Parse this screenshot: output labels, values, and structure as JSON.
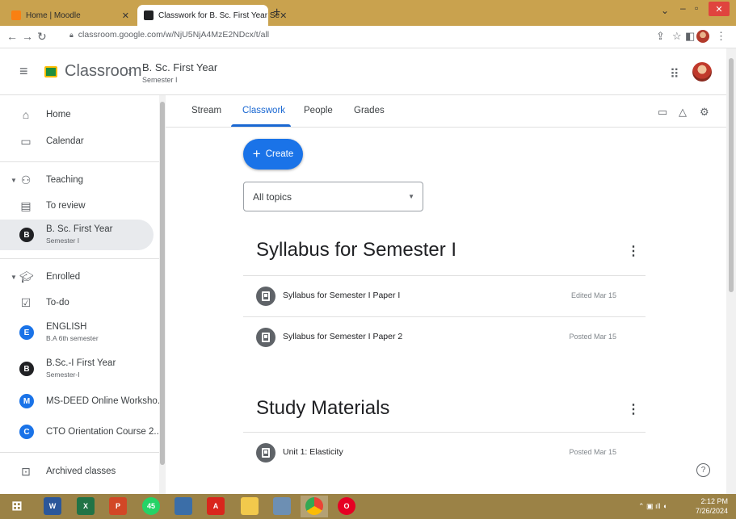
{
  "browser": {
    "tabs": [
      {
        "title": "Home | Moodle",
        "active": false
      },
      {
        "title": "Classwork for B. Sc. First Year Se",
        "active": true
      }
    ],
    "url": "classroom.google.com/w/NjU5NjA4MzE2NDcx/t/all"
  },
  "app": {
    "name": "Classroom",
    "class_title": "B. Sc. First Year",
    "class_subtitle": "Semester I"
  },
  "sidebar": {
    "home": "Home",
    "calendar": "Calendar",
    "teaching": "Teaching",
    "to_review": "To review",
    "teaching_classes": [
      {
        "initial": "B",
        "name": "B. Sc. First Year",
        "sub": "Semester I",
        "color": "#202124",
        "selected": true
      }
    ],
    "enrolled": "Enrolled",
    "todo": "To-do",
    "enrolled_classes": [
      {
        "initial": "E",
        "name": "ENGLISH",
        "sub": "B.A 6th semester",
        "color": "#1a73e8"
      },
      {
        "initial": "B",
        "name": "B.Sc.-I First Year",
        "sub": "Semester-I",
        "color": "#202124"
      },
      {
        "initial": "M",
        "name": "MS-DEED Online Worksho...",
        "sub": "",
        "color": "#1a73e8"
      },
      {
        "initial": "C",
        "name": "CTO Orientation Course 2...",
        "sub": "",
        "color": "#1a73e8"
      }
    ],
    "archived": "Archived classes"
  },
  "class_tabs": [
    "Stream",
    "Classwork",
    "People",
    "Grades"
  ],
  "active_tab": "Classwork",
  "create_label": "Create",
  "topics_filter": "All topics",
  "sections": [
    {
      "title": "Syllabus for Semester I",
      "items": [
        {
          "title": "Syllabus for Semester I Paper I",
          "date": "Edited Mar 15"
        },
        {
          "title": "Syllabus for Semester I Paper 2",
          "date": "Posted Mar 15"
        }
      ]
    },
    {
      "title": "Study Materials",
      "items": [
        {
          "title": "Unit 1: Elasticity",
          "date": "Posted Mar 15"
        }
      ]
    }
  ],
  "taskbar": {
    "time": "2:12 PM",
    "date": "7/26/2024",
    "whatsapp_badge": "45"
  },
  "colors": {
    "accent": "#1967d2",
    "create_button": "#1a73e8",
    "chrome_frame": "#c9a24e",
    "taskbar": "#9b8246"
  }
}
